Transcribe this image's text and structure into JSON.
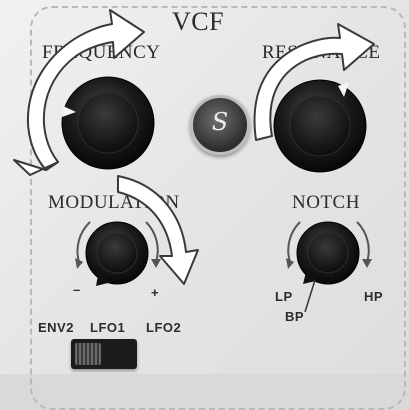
{
  "section": {
    "title": "VCF"
  },
  "knobs": {
    "frequency": {
      "label": "FREQUENCY"
    },
    "resonance": {
      "label": "RESONANCE"
    },
    "modulation": {
      "label": "MODULATION",
      "minus": "–",
      "plus": "+"
    },
    "notch": {
      "label": "NOTCH",
      "lp": "LP",
      "bp": "BP",
      "hp": "HP"
    }
  },
  "mod_source": {
    "options": [
      "ENV2",
      "LFO1",
      "LFO2"
    ],
    "selected": "ENV2"
  },
  "logo": {
    "glyph": "S"
  },
  "colors": {
    "panel": "#e6e6e6",
    "knob": "#1a1a1a",
    "arrow_fill": "#ffffff",
    "arrow_stroke": "#3a3a3a"
  },
  "icons": [
    "curved-rotate-arrow-icon",
    "brand-logo-icon",
    "rotation-direction-arrow-icon"
  ]
}
